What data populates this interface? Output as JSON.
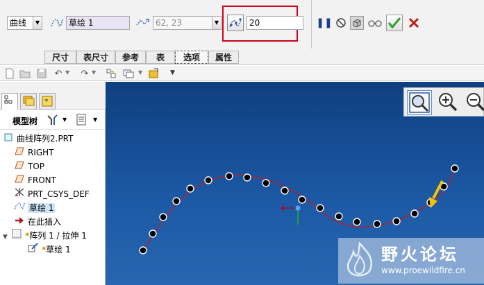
{
  "dashboard": {
    "type_value": "曲线",
    "sketch_value": "草绘 1",
    "coords_value": "62, 23",
    "count_value": "20",
    "tabs": [
      "尺寸",
      "表尺寸",
      "参考",
      "表",
      "选项",
      "属性"
    ]
  },
  "tree": {
    "title": "模型树",
    "items": [
      {
        "label": "曲线阵列2.PRT",
        "icon": "part-icon"
      },
      {
        "label": "RIGHT",
        "icon": "datum-plane-icon"
      },
      {
        "label": "TOP",
        "icon": "datum-plane-icon"
      },
      {
        "label": "FRONT",
        "icon": "datum-plane-icon"
      },
      {
        "label": "PRT_CSYS_DEF",
        "icon": "csys-icon"
      },
      {
        "label": "草绘 1",
        "icon": "sketch-icon"
      },
      {
        "label": "在此插入",
        "icon": "insert-arrow-icon"
      },
      {
        "label": "阵列 1 / 拉伸 1",
        "icon": "pattern-icon"
      },
      {
        "label": "草绘 1",
        "icon": "sketch-icon"
      }
    ]
  },
  "watermark": {
    "title": "野火论坛",
    "url": "www.proewildfire.cn"
  },
  "colors": {
    "viewport_top": "#0e3f80",
    "viewport_bottom": "#2766b0",
    "curve": "#a0283c",
    "highlight_box": "#d0021b",
    "ok_green": "#2e9e2e",
    "cancel_red": "#c01818"
  }
}
